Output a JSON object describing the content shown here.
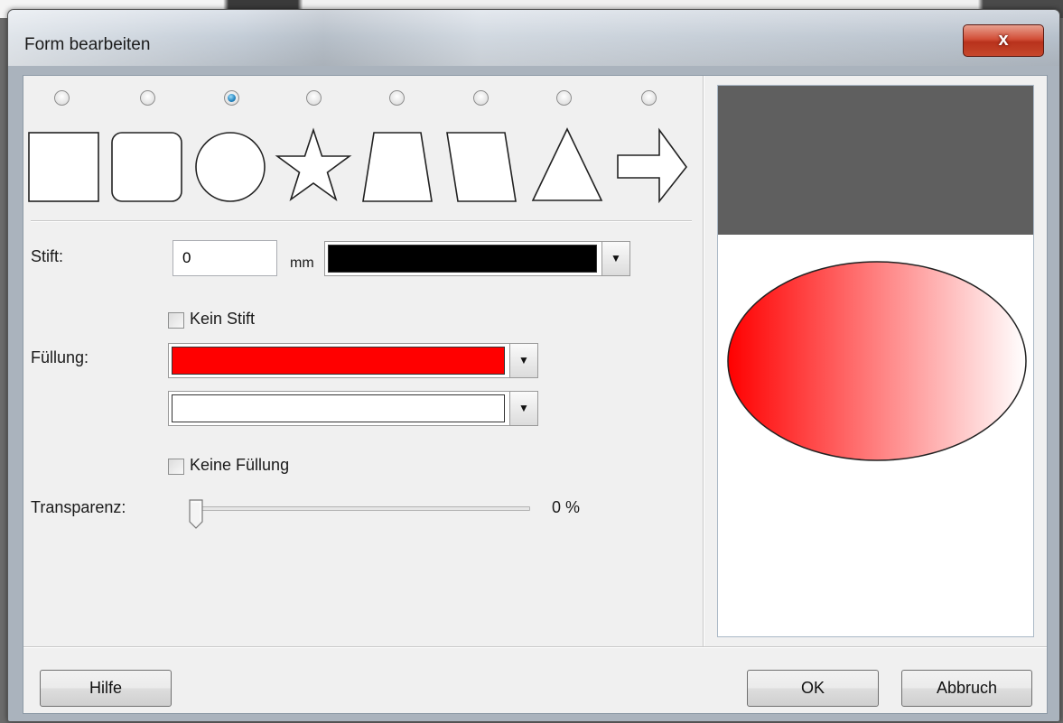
{
  "window": {
    "title": "Form bearbeiten",
    "close_label": "x"
  },
  "shapes": {
    "selected_index": 2,
    "items": [
      {
        "name": "rectangle",
        "checked": false
      },
      {
        "name": "rounded-rectangle",
        "checked": false
      },
      {
        "name": "circle",
        "checked": true
      },
      {
        "name": "star",
        "checked": false
      },
      {
        "name": "trapezoid",
        "checked": false
      },
      {
        "name": "parallelogram",
        "checked": false
      },
      {
        "name": "triangle",
        "checked": false
      },
      {
        "name": "arrow",
        "checked": false
      }
    ]
  },
  "pen": {
    "label": "Stift:",
    "width_value": "0",
    "unit": "mm",
    "color": "#000000",
    "no_pen_label": "Kein Stift",
    "no_pen_checked": false
  },
  "fill": {
    "label": "Füllung:",
    "color1": "#ff0000",
    "color2": "#ffffff",
    "no_fill_label": "Keine Füllung",
    "no_fill_checked": false
  },
  "transparency": {
    "label": "Transparenz:",
    "value_percent": 0,
    "value_text": "0 %"
  },
  "preview": {
    "shape": "ellipse",
    "gradient_from": "#ff0000",
    "gradient_to": "#ffffff"
  },
  "buttons": {
    "help": "Hilfe",
    "ok": "OK",
    "cancel": "Abbruch"
  }
}
